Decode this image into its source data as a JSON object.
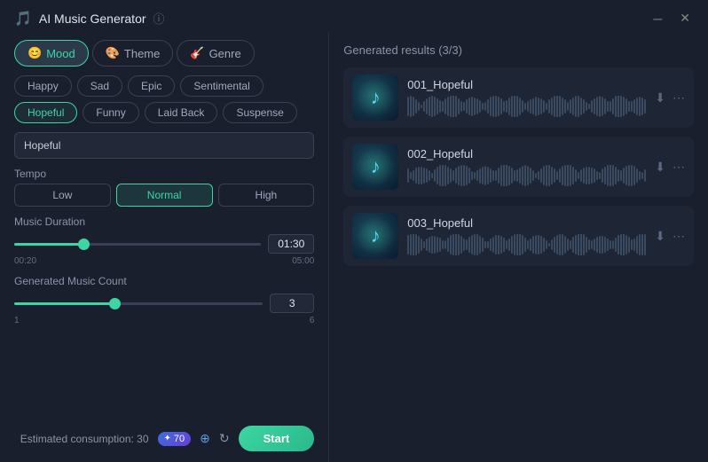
{
  "window": {
    "title": "AI Music Generator",
    "close_btn": "✕",
    "minimize_btn": "─"
  },
  "tabs": [
    {
      "id": "mood",
      "label": "Mood",
      "active": true
    },
    {
      "id": "theme",
      "label": "Theme",
      "active": false
    },
    {
      "id": "genre",
      "label": "Genre",
      "active": false
    }
  ],
  "moods": [
    {
      "label": "Happy",
      "selected": false
    },
    {
      "label": "Sad",
      "selected": false
    },
    {
      "label": "Epic",
      "selected": false
    },
    {
      "label": "Sentimental",
      "selected": false
    },
    {
      "label": "Hopeful",
      "selected": true
    },
    {
      "label": "Funny",
      "selected": false
    },
    {
      "label": "Laid Back",
      "selected": false
    },
    {
      "label": "Suspense",
      "selected": false
    }
  ],
  "mood_input": {
    "value": "Hopeful",
    "placeholder": "Hopeful"
  },
  "tempo": {
    "label": "Tempo",
    "options": [
      {
        "label": "Low",
        "active": false
      },
      {
        "label": "Normal",
        "active": true
      },
      {
        "label": "High",
        "active": false
      }
    ]
  },
  "duration": {
    "label": "Music Duration",
    "min": "00:20",
    "max": "05:00",
    "value": "01:30",
    "fill_pct": "27"
  },
  "count": {
    "label": "Generated Music Count",
    "min": "1",
    "max": "6",
    "value": "3",
    "fill_pct": "40"
  },
  "bottom": {
    "consumption_label": "Estimated consumption: 30",
    "credits": "70",
    "start_label": "Start"
  },
  "results": {
    "header": "Generated results (3/3)",
    "items": [
      {
        "name": "001_Hopeful"
      },
      {
        "name": "002_Hopeful"
      },
      {
        "name": "003_Hopeful"
      }
    ]
  }
}
